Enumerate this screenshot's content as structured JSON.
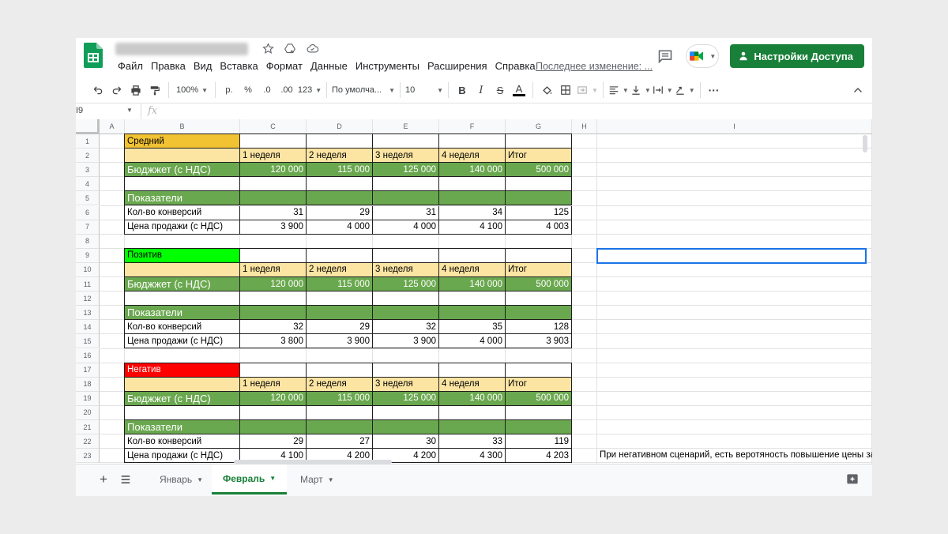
{
  "menu": [
    "Файл",
    "Правка",
    "Вид",
    "Вставка",
    "Формат",
    "Данные",
    "Инструменты",
    "Расширения",
    "Справка"
  ],
  "last_edit": "Последнее изменение: ...",
  "share_label": "Настройки Доступа",
  "toolbar": {
    "zoom": "100%",
    "currency": "р.",
    "percent": "%",
    "dec_less": ".0",
    "dec_more": ".00",
    "format_more": "123",
    "font": "По умолча...",
    "size": "10",
    "bold": "B",
    "italic": "I",
    "strike": "S",
    "textcolor": "A",
    "more": "···"
  },
  "formula_bar": {
    "ref": "I9",
    "fx": "fx"
  },
  "columns": [
    "A",
    "B",
    "C",
    "D",
    "E",
    "F",
    "G",
    "H",
    "I"
  ],
  "rows": [
    "1",
    "2",
    "3",
    "4",
    "5",
    "6",
    "7",
    "8",
    "9",
    "10",
    "11",
    "12",
    "13",
    "14",
    "15",
    "16",
    "17",
    "18",
    "19",
    "20",
    "21",
    "22",
    "23"
  ],
  "scenarios": [
    {
      "name": "Средний",
      "weeks": [
        "1 неделя",
        "2 неделя",
        "3 неделя",
        "4 неделя",
        "Итог"
      ],
      "budget_label": "Бюджжет (с НДС)",
      "budget": [
        "120 000",
        "115 000",
        "125 000",
        "140 000",
        "500 000"
      ],
      "indicators_label": "Показатели",
      "conv_label": "Кол-во конверсий",
      "conversions": [
        "31",
        "29",
        "31",
        "34",
        "125"
      ],
      "price_label": "Цена продажи (с НДС)",
      "prices": [
        "3 900",
        "4 000",
        "4 000",
        "4 100",
        "4 003"
      ]
    },
    {
      "name": "Позитив",
      "weeks": [
        "1 неделя",
        "2 неделя",
        "3 неделя",
        "4 неделя",
        "Итог"
      ],
      "budget_label": "Бюджжет (с НДС)",
      "budget": [
        "120 000",
        "115 000",
        "125 000",
        "140 000",
        "500 000"
      ],
      "indicators_label": "Показатели",
      "conv_label": "Кол-во конверсий",
      "conversions": [
        "32",
        "29",
        "32",
        "35",
        "128"
      ],
      "price_label": "Цена продажи (с НДС)",
      "prices": [
        "3 800",
        "3 900",
        "3 900",
        "4 000",
        "3 903"
      ]
    },
    {
      "name": "Негатив",
      "weeks": [
        "1 неделя",
        "2 неделя",
        "3 неделя",
        "4 неделя",
        "Итог"
      ],
      "budget_label": "Бюджжет (с НДС)",
      "budget": [
        "120 000",
        "115 000",
        "125 000",
        "140 000",
        "500 000"
      ],
      "indicators_label": "Показатели",
      "conv_label": "Кол-во конверсий",
      "conversions": [
        "29",
        "27",
        "30",
        "33",
        "119"
      ],
      "price_label": "Цена продажи (с НДС)",
      "prices": [
        "4 100",
        "4 200",
        "4 200",
        "4 300",
        "4 203"
      ]
    }
  ],
  "note": "При негативном сценарий, есть веротяность повышение цены за",
  "sheets": [
    {
      "label": "Январь",
      "active": false
    },
    {
      "label": "Февраль",
      "active": true
    },
    {
      "label": "Март",
      "active": false
    }
  ],
  "colors": {
    "header_yellow": "#fce5a3",
    "green": "#6aa84f",
    "accent": "#188038",
    "medium": "#f1c232",
    "positive": "#00ff00",
    "negative": "#ff0000"
  }
}
